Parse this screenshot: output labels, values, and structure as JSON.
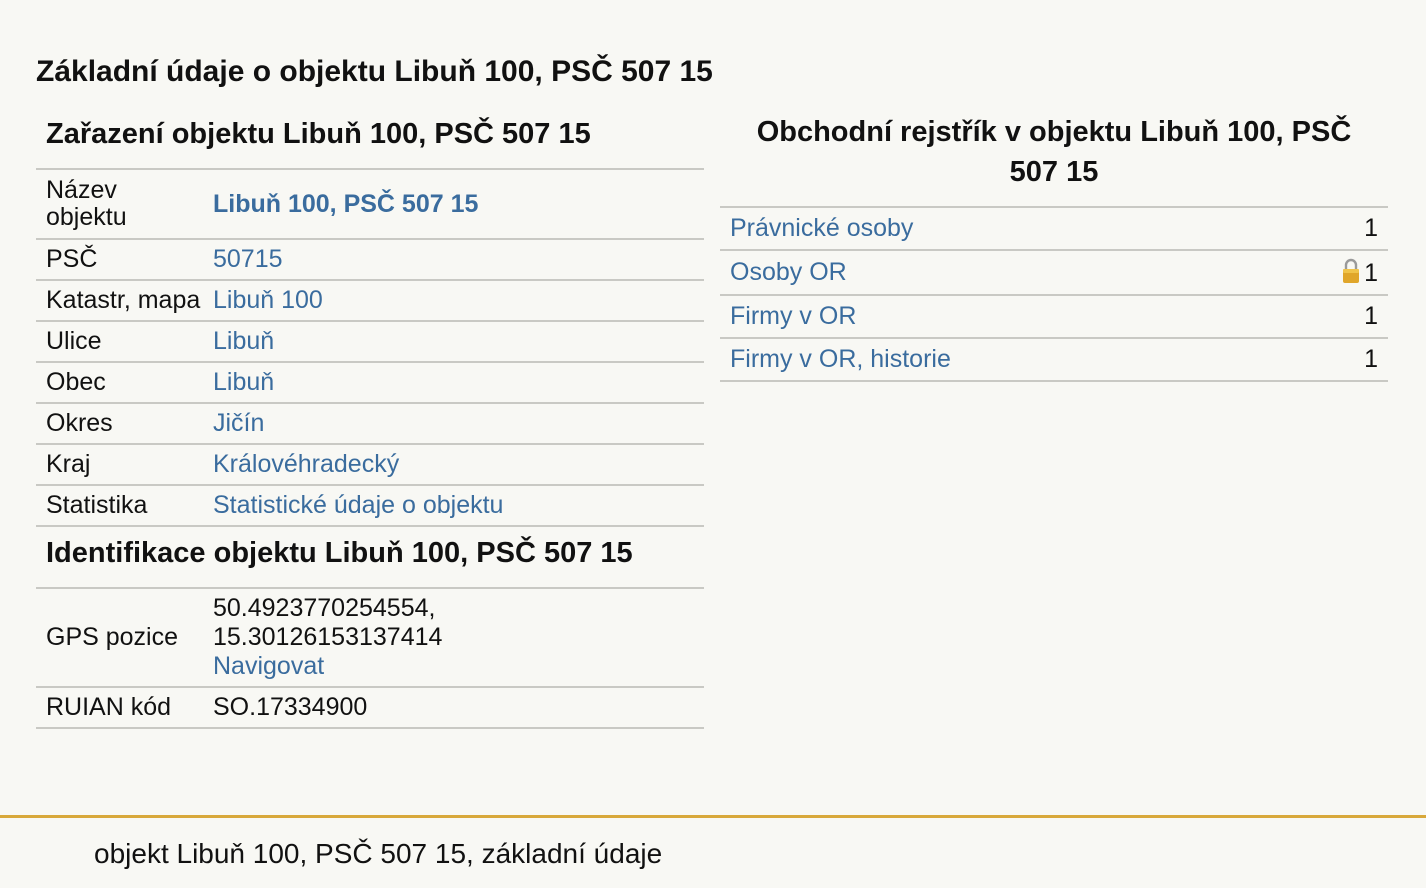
{
  "main_title": "Základní údaje o objektu Libuň 100, PSČ 507 15",
  "zarazeni": {
    "heading": "Zařazení objektu Libuň 100, PSČ 507 15",
    "rows": [
      {
        "key": "Název objektu",
        "value": "Libuň 100, PSČ 507 15"
      },
      {
        "key": "PSČ",
        "value": "50715"
      },
      {
        "key": "Katastr, mapa",
        "value": "Libuň 100"
      },
      {
        "key": "Ulice",
        "value": "Libuň"
      },
      {
        "key": "Obec",
        "value": "Libuň"
      },
      {
        "key": "Okres",
        "value": "Jičín"
      },
      {
        "key": "Kraj",
        "value": "Královéhradecký"
      },
      {
        "key": "Statistika",
        "value": "Statistické údaje o objektu"
      }
    ]
  },
  "identifikace": {
    "heading": "Identifikace objektu Libuň 100, PSČ 507 15",
    "gps": {
      "key": "GPS pozice",
      "lat": "50.4923770254554,",
      "lon": "15.30126153137414",
      "navigate": "Navigovat"
    },
    "ruian": {
      "key": "RUIAN kód",
      "value": "SO.17334900"
    }
  },
  "obchodni": {
    "heading": "Obchodní rejstřík v objektu Libuň 100, PSČ 507 15",
    "rows": [
      {
        "label": "Právnické osoby",
        "count": "1",
        "locked": false
      },
      {
        "label": "Osoby OR",
        "count": "1",
        "locked": true
      },
      {
        "label": "Firmy v OR",
        "count": "1",
        "locked": false
      },
      {
        "label": "Firmy v OR, historie",
        "count": "1",
        "locked": false
      }
    ]
  },
  "footer": {
    "text": "objekt Libuň 100, PSČ 507 15, základní údaje"
  },
  "colors": {
    "link": "#3a6c9e",
    "background": "#f8f8f4",
    "footer_rule": "#d8a83a",
    "row_border": "#c9c9c4"
  },
  "icons": {
    "lock": "lock-icon"
  }
}
